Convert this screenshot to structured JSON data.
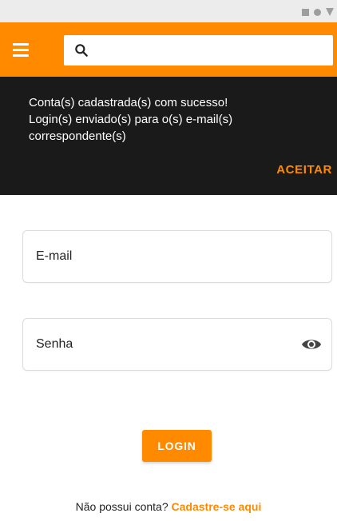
{
  "colors": {
    "accent": "#ff8a00",
    "snackbar_bg": "#1a1a1a",
    "status_bar_bg": "#ececec"
  },
  "app_bar": {
    "menu_icon": "hamburger-menu-icon",
    "search_icon": "search-icon",
    "search_value": ""
  },
  "snackbar": {
    "message": "Conta(s) cadastrada(s) com sucesso!\nLogin(s) enviado(s) para o(s) e-mail(s)\ncorrespondente(s)",
    "action_label": "ACEITAR"
  },
  "login_form": {
    "email_placeholder": "E-mail",
    "password_placeholder": "Senha",
    "password_toggle_icon": "eye-icon",
    "submit_label": "LOGIN"
  },
  "signup": {
    "prompt": "Não possui conta?",
    "link_label": "Cadastre-se aqui"
  }
}
